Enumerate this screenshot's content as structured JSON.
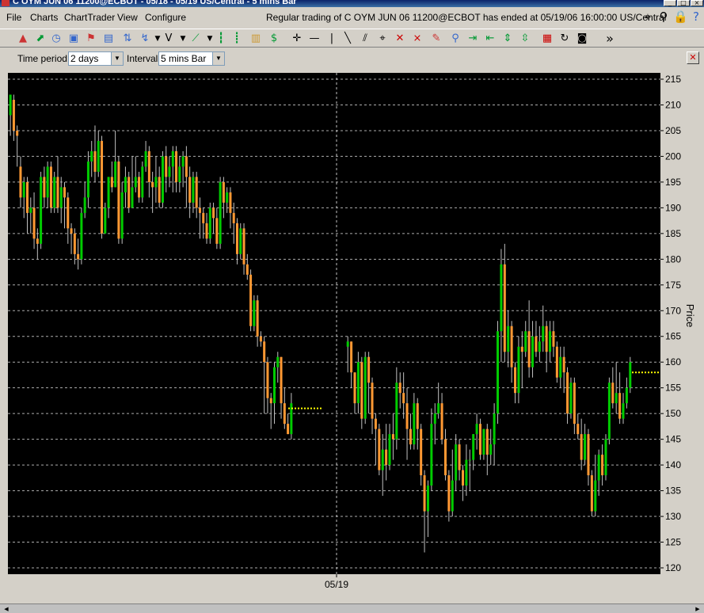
{
  "window": {
    "title": "C OYM  JUN 06  11200@ECBOT - 05/18 - 05/19 US/Central - 5 mins Bar",
    "minimize": "_",
    "maximize": "□",
    "close": "×"
  },
  "menu": {
    "file": "File",
    "charts": "Charts",
    "charttrader": "ChartTrader",
    "view": "View",
    "configure": "Configure"
  },
  "status_message": "Regular trading of C OYM  JUN 06  11200@ECBOT has ended at 05/19/06 16:00:00 US/Central",
  "toolbar": {
    "more": "»"
  },
  "params": {
    "time_period_label": "Time period:",
    "time_period_value": "2 days",
    "interval_label": "Interval:",
    "interval_value": "5 mins Bar"
  },
  "colors": {
    "background": "#000000",
    "up_bar": "#00cc00",
    "down_bar": "#ff9933",
    "wick": "#c0c0c0",
    "close_marker": "#ffff00",
    "grid": "#c0c0c0"
  },
  "chart_data": {
    "type": "candlestick",
    "ylabel": "Price",
    "ylim": [
      120,
      215
    ],
    "yticks": [
      120,
      125,
      130,
      135,
      140,
      145,
      150,
      155,
      160,
      165,
      170,
      175,
      180,
      185,
      190,
      195,
      200,
      205,
      210,
      215
    ],
    "xlabel_tick": "05/19",
    "grid": "horizontal dashed + vertical dashed at session divide",
    "session1": [
      {
        "o": 208,
        "c": 212,
        "h": 212,
        "l": 204
      },
      {
        "o": 211,
        "c": 205,
        "h": 212,
        "l": 203
      },
      {
        "o": 205,
        "c": 204,
        "h": 206,
        "l": 198
      },
      {
        "o": 198,
        "c": 192,
        "h": 200,
        "l": 190
      },
      {
        "o": 192,
        "c": 195,
        "h": 196,
        "l": 188
      },
      {
        "o": 195,
        "c": 189,
        "h": 196,
        "l": 185
      },
      {
        "o": 189,
        "c": 190,
        "h": 192,
        "l": 185
      },
      {
        "o": 190,
        "c": 184,
        "h": 193,
        "l": 182
      },
      {
        "o": 184,
        "c": 183,
        "h": 186,
        "l": 180
      },
      {
        "o": 183,
        "c": 196,
        "h": 197,
        "l": 182
      },
      {
        "o": 196,
        "c": 192,
        "h": 198,
        "l": 190
      },
      {
        "o": 192,
        "c": 198,
        "h": 199,
        "l": 190
      },
      {
        "o": 198,
        "c": 190,
        "h": 199,
        "l": 189
      },
      {
        "o": 190,
        "c": 196,
        "h": 197,
        "l": 189
      },
      {
        "o": 196,
        "c": 190,
        "h": 200,
        "l": 189
      },
      {
        "o": 190,
        "c": 194,
        "h": 196,
        "l": 187
      },
      {
        "o": 194,
        "c": 192,
        "h": 195,
        "l": 186
      },
      {
        "o": 192,
        "c": 186,
        "h": 193,
        "l": 183
      },
      {
        "o": 186,
        "c": 185,
        "h": 187,
        "l": 181
      },
      {
        "o": 185,
        "c": 181,
        "h": 186,
        "l": 179
      },
      {
        "o": 181,
        "c": 180,
        "h": 184,
        "l": 178
      },
      {
        "o": 180,
        "c": 189,
        "h": 190,
        "l": 179
      },
      {
        "o": 189,
        "c": 192,
        "h": 195,
        "l": 188
      },
      {
        "o": 192,
        "c": 199,
        "h": 201,
        "l": 190
      },
      {
        "o": 199,
        "c": 201,
        "h": 203,
        "l": 196
      },
      {
        "o": 201,
        "c": 197,
        "h": 206,
        "l": 195
      },
      {
        "o": 197,
        "c": 203,
        "h": 205,
        "l": 196
      },
      {
        "o": 203,
        "c": 185,
        "h": 204,
        "l": 184
      },
      {
        "o": 185,
        "c": 190,
        "h": 191,
        "l": 185
      },
      {
        "o": 190,
        "c": 196,
        "h": 196,
        "l": 188
      },
      {
        "o": 196,
        "c": 194,
        "h": 199,
        "l": 193
      },
      {
        "o": 194,
        "c": 199,
        "h": 205,
        "l": 194
      },
      {
        "o": 199,
        "c": 184,
        "h": 200,
        "l": 183
      },
      {
        "o": 184,
        "c": 193,
        "h": 195,
        "l": 183
      },
      {
        "o": 193,
        "c": 196,
        "h": 198,
        "l": 190
      },
      {
        "o": 196,
        "c": 190,
        "h": 197,
        "l": 189
      },
      {
        "o": 190,
        "c": 194,
        "h": 200,
        "l": 190
      },
      {
        "o": 194,
        "c": 196,
        "h": 200,
        "l": 193
      },
      {
        "o": 196,
        "c": 192,
        "h": 197,
        "l": 191
      },
      {
        "o": 192,
        "c": 198,
        "h": 199,
        "l": 191
      },
      {
        "o": 198,
        "c": 201,
        "h": 203,
        "l": 197
      },
      {
        "o": 201,
        "c": 195,
        "h": 202,
        "l": 192
      },
      {
        "o": 195,
        "c": 194,
        "h": 197,
        "l": 189
      },
      {
        "o": 194,
        "c": 196,
        "h": 200,
        "l": 191
      },
      {
        "o": 196,
        "c": 191,
        "h": 198,
        "l": 190
      },
      {
        "o": 191,
        "c": 200,
        "h": 201,
        "l": 190
      },
      {
        "o": 200,
        "c": 196,
        "h": 202,
        "l": 193
      },
      {
        "o": 196,
        "c": 198,
        "h": 200,
        "l": 194
      },
      {
        "o": 198,
        "c": 201,
        "h": 202,
        "l": 193
      },
      {
        "o": 201,
        "c": 195,
        "h": 202,
        "l": 193
      },
      {
        "o": 195,
        "c": 198,
        "h": 200,
        "l": 193
      },
      {
        "o": 198,
        "c": 200,
        "h": 201,
        "l": 194
      },
      {
        "o": 200,
        "c": 196,
        "h": 202,
        "l": 190
      },
      {
        "o": 196,
        "c": 191,
        "h": 198,
        "l": 188
      },
      {
        "o": 191,
        "c": 196,
        "h": 197,
        "l": 189
      },
      {
        "o": 196,
        "c": 190,
        "h": 197,
        "l": 188
      },
      {
        "o": 190,
        "c": 189,
        "h": 192,
        "l": 184
      },
      {
        "o": 189,
        "c": 187,
        "h": 190,
        "l": 184
      },
      {
        "o": 187,
        "c": 184,
        "h": 189,
        "l": 183
      },
      {
        "o": 184,
        "c": 190,
        "h": 191,
        "l": 183
      },
      {
        "o": 190,
        "c": 188,
        "h": 191,
        "l": 185
      },
      {
        "o": 188,
        "c": 183,
        "h": 190,
        "l": 182
      },
      {
        "o": 183,
        "c": 195,
        "h": 196,
        "l": 182
      },
      {
        "o": 195,
        "c": 191,
        "h": 196,
        "l": 188
      },
      {
        "o": 191,
        "c": 193,
        "h": 194,
        "l": 189
      },
      {
        "o": 193,
        "c": 189,
        "h": 194,
        "l": 186
      },
      {
        "o": 189,
        "c": 187,
        "h": 191,
        "l": 183
      },
      {
        "o": 187,
        "c": 181,
        "h": 188,
        "l": 179
      },
      {
        "o": 181,
        "c": 186,
        "h": 187,
        "l": 180
      },
      {
        "o": 186,
        "c": 179,
        "h": 187,
        "l": 177
      },
      {
        "o": 179,
        "c": 177,
        "h": 181,
        "l": 176
      },
      {
        "o": 177,
        "c": 167,
        "h": 178,
        "l": 166
      },
      {
        "o": 167,
        "c": 172,
        "h": 173,
        "l": 166
      },
      {
        "o": 172,
        "c": 165,
        "h": 173,
        "l": 163
      },
      {
        "o": 165,
        "c": 164,
        "h": 166,
        "l": 163
      },
      {
        "o": 164,
        "c": 160,
        "h": 165,
        "l": 150
      },
      {
        "o": 160,
        "c": 153,
        "h": 161,
        "l": 150
      },
      {
        "o": 153,
        "c": 152,
        "h": 154,
        "l": 147
      },
      {
        "o": 152,
        "c": 159,
        "h": 160,
        "l": 148
      },
      {
        "o": 159,
        "c": 161,
        "h": 162,
        "l": 156
      },
      {
        "o": 161,
        "c": 152,
        "h": 161,
        "l": 149
      },
      {
        "o": 152,
        "c": 148,
        "h": 155,
        "l": 147
      },
      {
        "o": 148,
        "c": 146,
        "h": 150,
        "l": 146
      },
      {
        "o": 146,
        "c": 152,
        "h": 154,
        "l": 145
      }
    ],
    "session1_close": 151,
    "session2": [
      {
        "o": 163,
        "c": 164,
        "h": 165,
        "l": 158
      },
      {
        "o": 164,
        "c": 158,
        "h": 164,
        "l": 155
      },
      {
        "o": 158,
        "c": 152,
        "h": 158,
        "l": 150
      },
      {
        "o": 152,
        "c": 160,
        "h": 162,
        "l": 150
      },
      {
        "o": 160,
        "c": 149,
        "h": 161,
        "l": 147
      },
      {
        "o": 149,
        "c": 161,
        "h": 162,
        "l": 148
      },
      {
        "o": 161,
        "c": 156,
        "h": 162,
        "l": 150
      },
      {
        "o": 156,
        "c": 149,
        "h": 157,
        "l": 146
      },
      {
        "o": 149,
        "c": 147,
        "h": 150,
        "l": 140
      },
      {
        "o": 147,
        "c": 139,
        "h": 148,
        "l": 138
      },
      {
        "o": 139,
        "c": 143,
        "h": 146,
        "l": 134
      },
      {
        "o": 143,
        "c": 140,
        "h": 148,
        "l": 137
      },
      {
        "o": 140,
        "c": 146,
        "h": 148,
        "l": 139
      },
      {
        "o": 146,
        "c": 145,
        "h": 150,
        "l": 141
      },
      {
        "o": 145,
        "c": 156,
        "h": 159,
        "l": 143
      },
      {
        "o": 156,
        "c": 154,
        "h": 158,
        "l": 151
      },
      {
        "o": 154,
        "c": 152,
        "h": 158,
        "l": 149
      },
      {
        "o": 152,
        "c": 147,
        "h": 155,
        "l": 141
      },
      {
        "o": 147,
        "c": 144,
        "h": 150,
        "l": 143
      },
      {
        "o": 144,
        "c": 152,
        "h": 154,
        "l": 143
      },
      {
        "o": 152,
        "c": 147,
        "h": 153,
        "l": 143
      },
      {
        "o": 147,
        "c": 138,
        "h": 148,
        "l": 136
      },
      {
        "o": 138,
        "c": 131,
        "h": 139,
        "l": 123
      },
      {
        "o": 131,
        "c": 136,
        "h": 137,
        "l": 126
      },
      {
        "o": 136,
        "c": 148,
        "h": 151,
        "l": 135
      },
      {
        "o": 148,
        "c": 150,
        "h": 152,
        "l": 144
      },
      {
        "o": 150,
        "c": 152,
        "h": 156,
        "l": 149
      },
      {
        "o": 152,
        "c": 145,
        "h": 154,
        "l": 144
      },
      {
        "o": 145,
        "c": 138,
        "h": 147,
        "l": 137
      },
      {
        "o": 138,
        "c": 131,
        "h": 139,
        "l": 129
      },
      {
        "o": 131,
        "c": 137,
        "h": 143,
        "l": 130
      },
      {
        "o": 137,
        "c": 144,
        "h": 146,
        "l": 135
      },
      {
        "o": 144,
        "c": 139,
        "h": 145,
        "l": 137
      },
      {
        "o": 139,
        "c": 136,
        "h": 140,
        "l": 133
      },
      {
        "o": 136,
        "c": 141,
        "h": 144,
        "l": 134
      },
      {
        "o": 141,
        "c": 141,
        "h": 143,
        "l": 135
      },
      {
        "o": 141,
        "c": 146,
        "h": 146,
        "l": 139
      },
      {
        "o": 146,
        "c": 148,
        "h": 150,
        "l": 143
      },
      {
        "o": 148,
        "c": 142,
        "h": 149,
        "l": 141
      },
      {
        "o": 142,
        "c": 147,
        "h": 147,
        "l": 141
      },
      {
        "o": 147,
        "c": 142,
        "h": 148,
        "l": 138
      },
      {
        "o": 142,
        "c": 144,
        "h": 147,
        "l": 140
      },
      {
        "o": 144,
        "c": 150,
        "h": 152,
        "l": 140
      },
      {
        "o": 150,
        "c": 166,
        "h": 168,
        "l": 148
      },
      {
        "o": 166,
        "c": 179,
        "h": 182,
        "l": 160
      },
      {
        "o": 179,
        "c": 162,
        "h": 183,
        "l": 160
      },
      {
        "o": 162,
        "c": 167,
        "h": 170,
        "l": 159
      },
      {
        "o": 167,
        "c": 159,
        "h": 168,
        "l": 156
      },
      {
        "o": 159,
        "c": 154,
        "h": 160,
        "l": 152
      },
      {
        "o": 154,
        "c": 163,
        "h": 165,
        "l": 152
      },
      {
        "o": 163,
        "c": 162,
        "h": 166,
        "l": 155
      },
      {
        "o": 162,
        "c": 166,
        "h": 168,
        "l": 161
      },
      {
        "o": 166,
        "c": 159,
        "h": 172,
        "l": 157
      },
      {
        "o": 159,
        "c": 165,
        "h": 168,
        "l": 157
      },
      {
        "o": 165,
        "c": 162,
        "h": 168,
        "l": 161
      },
      {
        "o": 162,
        "c": 164,
        "h": 167,
        "l": 160
      },
      {
        "o": 164,
        "c": 167,
        "h": 171,
        "l": 162
      },
      {
        "o": 167,
        "c": 162,
        "h": 168,
        "l": 158
      },
      {
        "o": 162,
        "c": 166,
        "h": 168,
        "l": 160
      },
      {
        "o": 166,
        "c": 163,
        "h": 168,
        "l": 161
      },
      {
        "o": 163,
        "c": 157,
        "h": 164,
        "l": 156
      },
      {
        "o": 157,
        "c": 161,
        "h": 163,
        "l": 155
      },
      {
        "o": 161,
        "c": 158,
        "h": 163,
        "l": 154
      },
      {
        "o": 158,
        "c": 150,
        "h": 159,
        "l": 148
      },
      {
        "o": 150,
        "c": 156,
        "h": 157,
        "l": 149
      },
      {
        "o": 156,
        "c": 148,
        "h": 157,
        "l": 146
      },
      {
        "o": 148,
        "c": 146,
        "h": 150,
        "l": 145
      },
      {
        "o": 146,
        "c": 141,
        "h": 149,
        "l": 139
      },
      {
        "o": 141,
        "c": 146,
        "h": 148,
        "l": 140
      },
      {
        "o": 146,
        "c": 138,
        "h": 147,
        "l": 136
      },
      {
        "o": 138,
        "c": 131,
        "h": 139,
        "l": 130
      },
      {
        "o": 131,
        "c": 137,
        "h": 142,
        "l": 130
      },
      {
        "o": 137,
        "c": 142,
        "h": 143,
        "l": 134
      },
      {
        "o": 142,
        "c": 138,
        "h": 144,
        "l": 136
      },
      {
        "o": 138,
        "c": 145,
        "h": 146,
        "l": 137
      },
      {
        "o": 145,
        "c": 156,
        "h": 157,
        "l": 144
      },
      {
        "o": 156,
        "c": 152,
        "h": 159,
        "l": 151
      },
      {
        "o": 152,
        "c": 154,
        "h": 160,
        "l": 150
      },
      {
        "o": 154,
        "c": 149,
        "h": 158,
        "l": 148
      },
      {
        "o": 149,
        "c": 152,
        "h": 154,
        "l": 148
      },
      {
        "o": 152,
        "c": 155,
        "h": 157,
        "l": 151
      },
      {
        "o": 155,
        "c": 160,
        "h": 161,
        "l": 154
      }
    ],
    "session2_close": 158
  }
}
